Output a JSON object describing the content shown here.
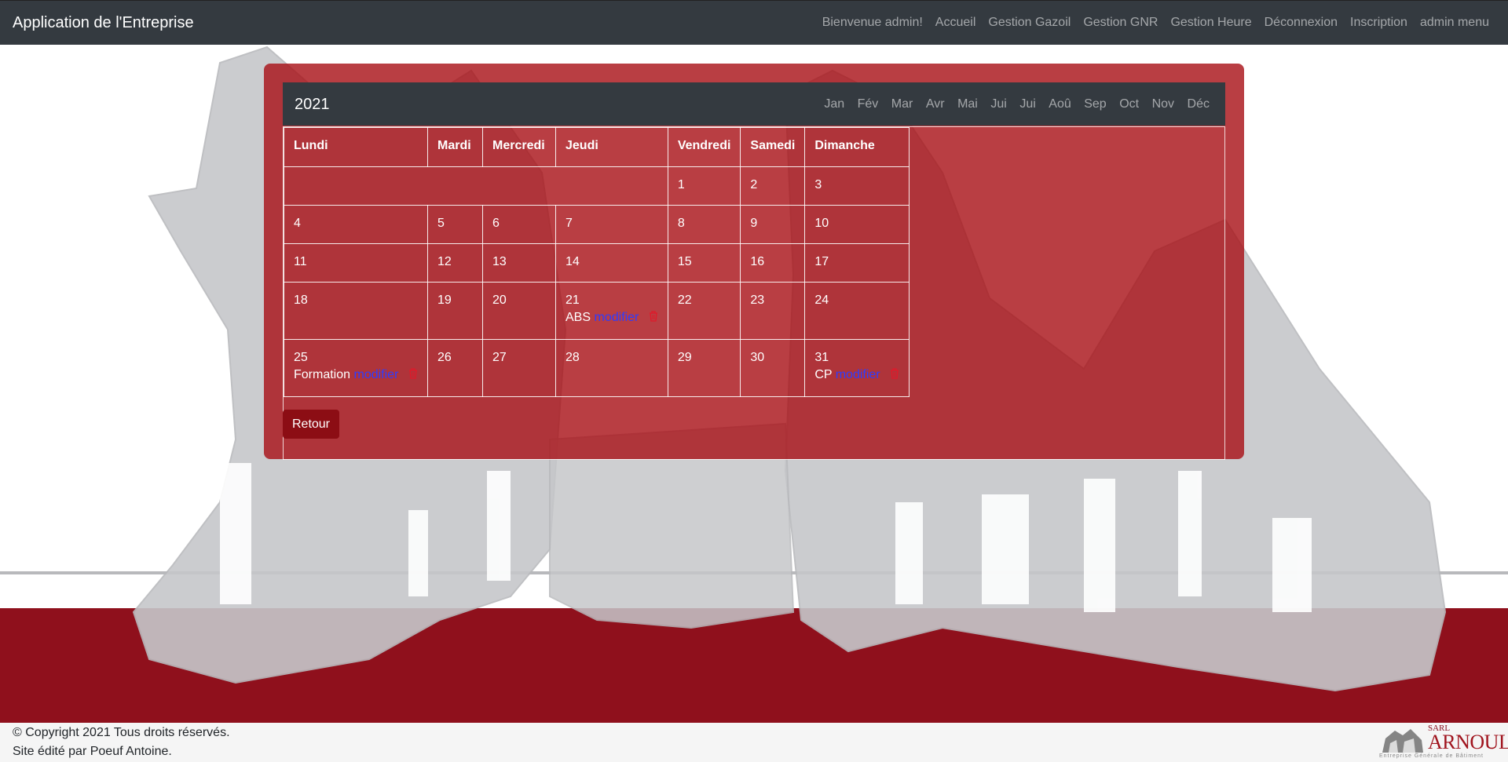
{
  "navbar": {
    "brand": "Application de l'Entreprise",
    "links": [
      "Bienvenue admin!",
      "Accueil",
      "Gestion Gazoil",
      "Gestion GNR",
      "Gestion Heure",
      "Déconnexion",
      "Inscription",
      "admin menu"
    ]
  },
  "calendar": {
    "year": "2021",
    "months": [
      "Jan",
      "Fév",
      "Mar",
      "Avr",
      "Mai",
      "Jui",
      "Jui",
      "Aoû",
      "Sep",
      "Oct",
      "Nov",
      "Déc"
    ],
    "weekdays": [
      "Lundi",
      "Mardi",
      "Mercredi",
      "Jeudi",
      "Vendredi",
      "Samedi",
      "Dimanche"
    ],
    "weeks": [
      [
        "",
        "",
        "",
        "",
        "1",
        "2",
        "3"
      ],
      [
        "4",
        "5",
        "6",
        "7",
        "8",
        "9",
        "10"
      ],
      [
        "11",
        "12",
        "13",
        "14",
        "15",
        "16",
        "17"
      ],
      [
        "18",
        "19",
        "20",
        "21",
        "22",
        "23",
        "24"
      ],
      [
        "25",
        "26",
        "27",
        "28",
        "29",
        "30",
        "31"
      ]
    ],
    "events": {
      "abs": {
        "label": "ABS",
        "link": "modifier"
      },
      "formation": {
        "label": "Formation",
        "link": "modifier"
      },
      "cp": {
        "label": "CP",
        "link": "modifier"
      }
    }
  },
  "back_button": "Retour",
  "footer": {
    "copyright": "© Copyright 2021 Tous droits réservés.",
    "editor": "Site édité par Poeuf Antoine.",
    "logo": {
      "sarl": "SARL",
      "name": "ARNOULT",
      "tagline": "Entreprise Générale de Bâtiment"
    }
  },
  "colors": {
    "navbar": "#343a40",
    "card": "#a80e14",
    "band": "#8f101c",
    "link": "#2d3cff"
  }
}
